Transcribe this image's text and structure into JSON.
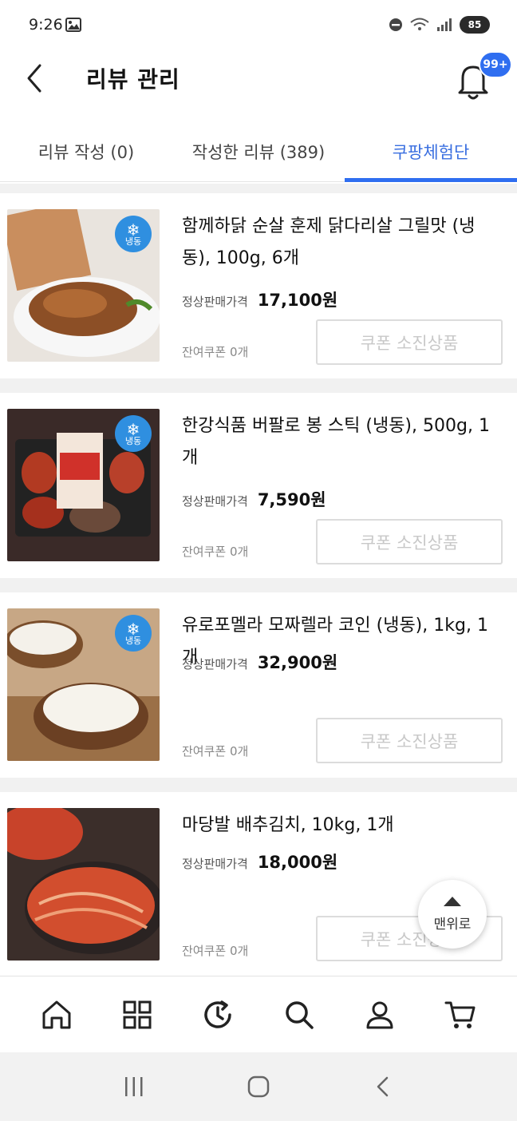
{
  "status": {
    "time": "9:26",
    "battery": "85"
  },
  "header": {
    "title": "리뷰 관리",
    "badge": "99+"
  },
  "tabs": [
    {
      "label": "리뷰 작성 (0)"
    },
    {
      "label": "작성한 리뷰 (389)"
    },
    {
      "label": "쿠팡체험단",
      "active": true
    }
  ],
  "products": [
    {
      "name": "함께하닭 순살 훈제 닭다리살 그릴맛 (냉동), 100g, 6개",
      "price_label": "정상판매가격",
      "price": "17,100원",
      "coupon": "잔여쿠폰 0개",
      "button": "쿠폰 소진상품",
      "frozen": "냉동"
    },
    {
      "name": "한강식품 버팔로 봉 스틱 (냉동), 500g, 1개",
      "price_label": "정상판매가격",
      "price": "7,590원",
      "coupon": "잔여쿠폰 0개",
      "button": "쿠폰 소진상품",
      "frozen": "냉동"
    },
    {
      "name": "유로포멜라 모짜렐라 코인 (냉동), 1kg, 1개",
      "price_label": "정상판매가격",
      "price": "32,900원",
      "coupon": "잔여쿠폰 0개",
      "button": "쿠폰 소진상품",
      "frozen": "냉동"
    },
    {
      "name": "마당발 배추김치, 10kg, 1개",
      "price_label": "정상판매가격",
      "price": "18,000원",
      "coupon": "잔여쿠폰 0개",
      "button": "쿠폰 소진상품"
    }
  ],
  "scroll_top": "맨위로",
  "bottom_nav": [
    "home-icon",
    "category-icon",
    "history-icon",
    "search-icon",
    "user-icon",
    "cart-icon"
  ],
  "colors": {
    "accent": "#2f6ef0",
    "frozen": "#2f8fe0"
  }
}
